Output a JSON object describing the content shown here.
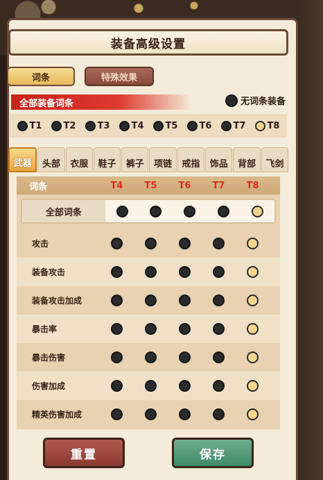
{
  "header": {
    "title": "装备高级设置"
  },
  "top_tabs": [
    {
      "label": "词条",
      "active": true
    },
    {
      "label": "特殊效果",
      "active": false
    }
  ],
  "section": {
    "title": "全部装备词条",
    "no_affix_label": "无词条装备"
  },
  "tiers": [
    {
      "label": "T1",
      "selected": false
    },
    {
      "label": "T2",
      "selected": false
    },
    {
      "label": "T3",
      "selected": false
    },
    {
      "label": "T4",
      "selected": false
    },
    {
      "label": "T5",
      "selected": false
    },
    {
      "label": "T6",
      "selected": false
    },
    {
      "label": "T7",
      "selected": false
    },
    {
      "label": "T8",
      "selected": true
    }
  ],
  "categories": [
    {
      "label": "武器",
      "active": true
    },
    {
      "label": "头部",
      "active": false
    },
    {
      "label": "衣服",
      "active": false
    },
    {
      "label": "鞋子",
      "active": false
    },
    {
      "label": "裤子",
      "active": false
    },
    {
      "label": "项链",
      "active": false
    },
    {
      "label": "戒指",
      "active": false
    },
    {
      "label": "饰品",
      "active": false
    },
    {
      "label": "背部",
      "active": false
    },
    {
      "label": "飞剑",
      "active": false
    }
  ],
  "table": {
    "header_label": "词条",
    "columns": [
      "T4",
      "T5",
      "T6",
      "T7",
      "T8"
    ],
    "all_row_label": "全部词条",
    "rows": [
      {
        "label": "攻击"
      },
      {
        "label": "装备攻击"
      },
      {
        "label": "装备攻击加成"
      },
      {
        "label": "暴击率"
      },
      {
        "label": "暴击伤害"
      },
      {
        "label": "伤害加成"
      },
      {
        "label": "精英伤害加成"
      }
    ],
    "selected_column": "T8"
  },
  "buttons": {
    "reset": "重置",
    "save": "保存"
  },
  "colors": {
    "accent_gold": "#f5d58e",
    "ribbon_red": "#c8221c",
    "save_green": "#3f8a66",
    "reset_red": "#8a3a30"
  }
}
